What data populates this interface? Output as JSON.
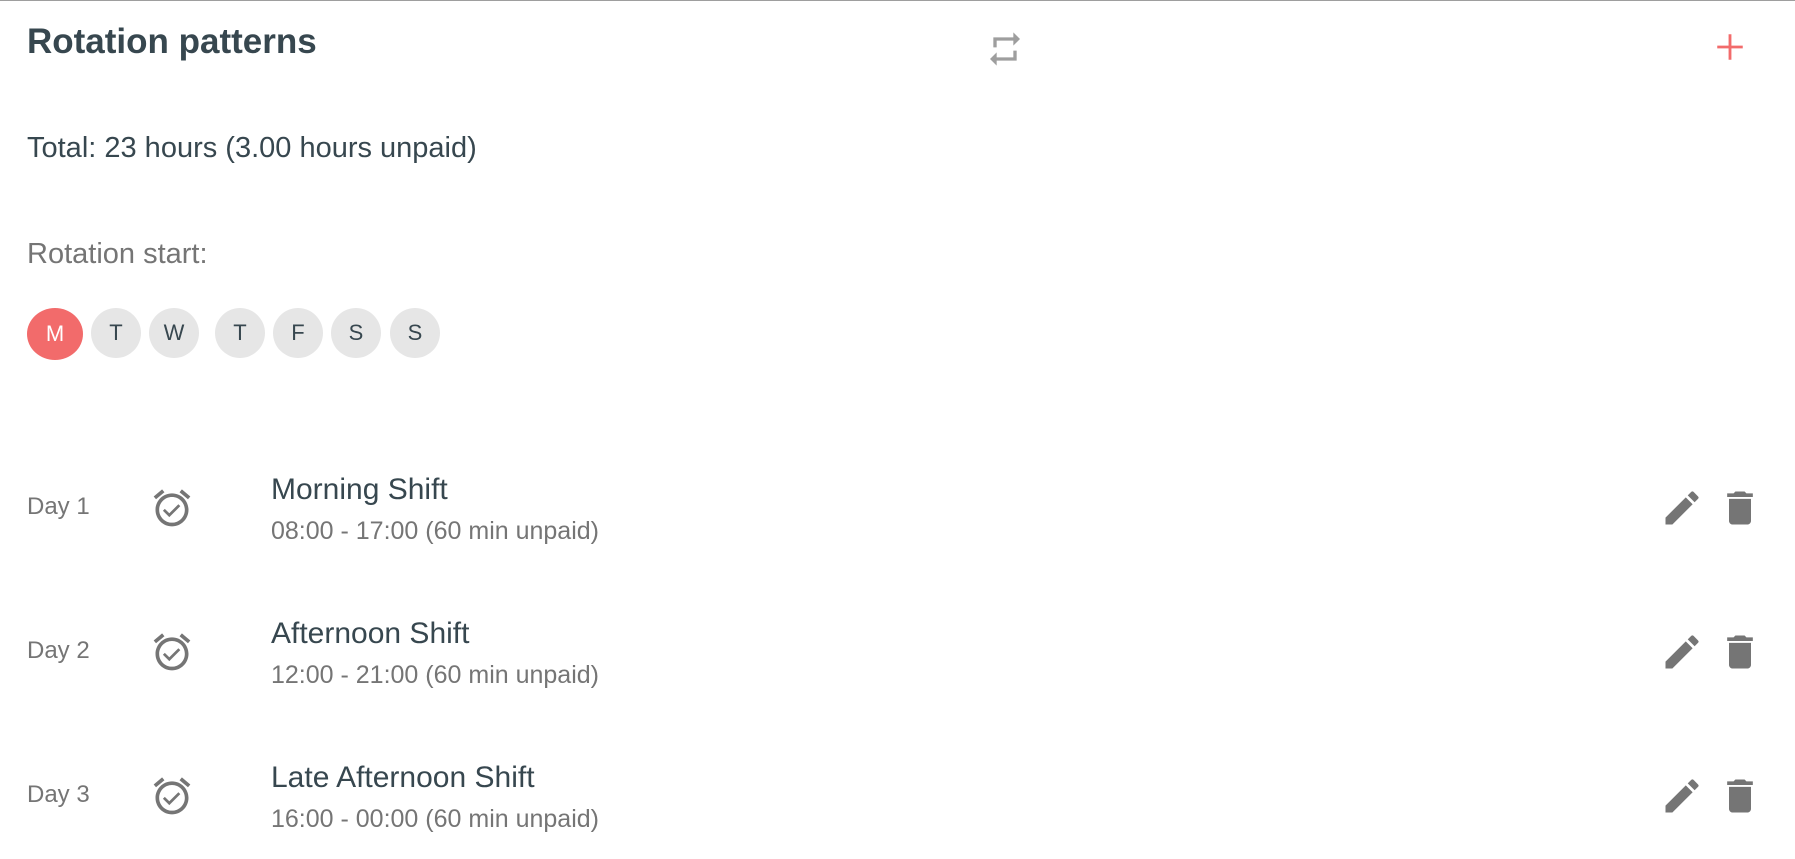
{
  "header": {
    "title": "Rotation patterns",
    "repeat_icon": "repeat-icon",
    "add_icon": "plus-icon",
    "accent_color": "#f26b6b"
  },
  "summary": {
    "total_text": "Total: 23 hours (3.00 hours unpaid)"
  },
  "rotation_start": {
    "label": "Rotation start:",
    "days": [
      {
        "label": "M",
        "selected": true
      },
      {
        "label": "T",
        "selected": false
      },
      {
        "label": "W",
        "selected": false
      },
      {
        "label": "T",
        "selected": false
      },
      {
        "label": "F",
        "selected": false
      },
      {
        "label": "S",
        "selected": false
      },
      {
        "label": "S",
        "selected": false
      }
    ]
  },
  "shifts": [
    {
      "day": "Day 1",
      "name": "Morning Shift",
      "time": "08:00 - 17:00 (60 min unpaid)"
    },
    {
      "day": "Day 2",
      "name": "Afternoon Shift",
      "time": "12:00 - 21:00 (60 min unpaid)"
    },
    {
      "day": "Day 3",
      "name": "Late Afternoon Shift",
      "time": "16:00 - 00:00 (60 min unpaid)"
    }
  ],
  "icons": {
    "alarm": "alarm-check-icon",
    "edit": "pencil-icon",
    "delete": "trash-icon"
  }
}
